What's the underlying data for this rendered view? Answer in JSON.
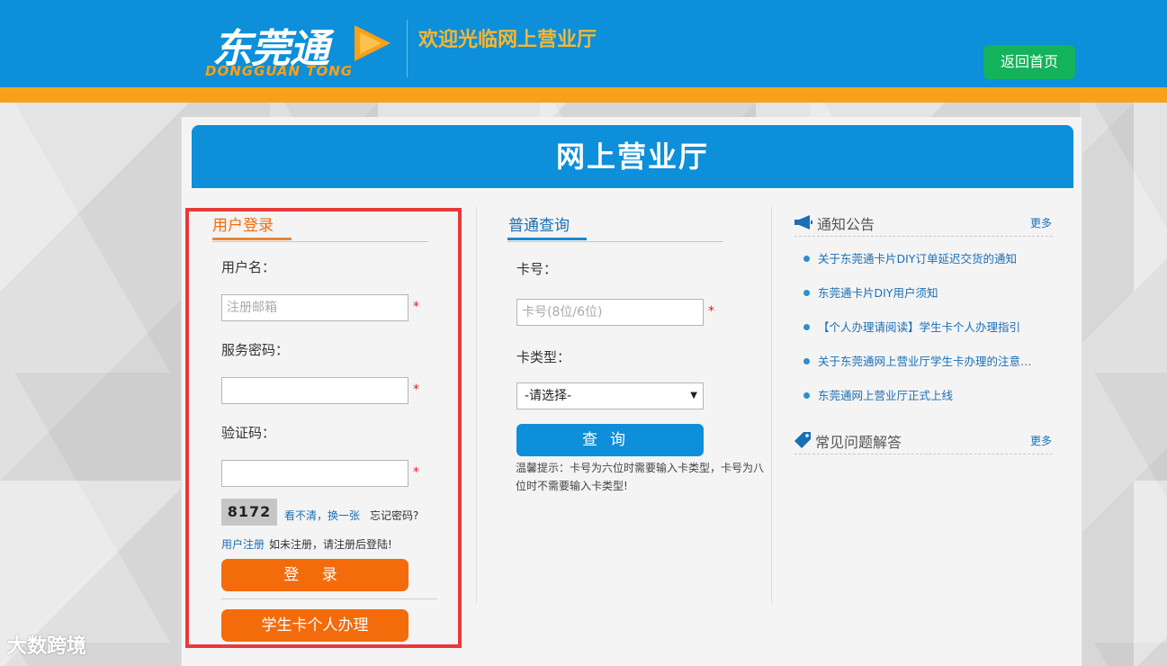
{
  "header": {
    "logo_cn": "东莞通",
    "logo_en": "DONGGUAN TONG",
    "welcome": "欢迎光临网上营业厅",
    "home_button": "返回首页"
  },
  "card_title": "网上营业厅",
  "login": {
    "tab": "用户登录",
    "username_label": "用户名：",
    "username_placeholder": "注册邮箱",
    "password_label": "服务密码：",
    "captcha_label": "验证码：",
    "required_mark": "*",
    "captcha_code": "8172",
    "refresh_captcha": "看不清，换一张",
    "forgot_password": "忘记密码?",
    "register_link": "用户注册",
    "register_hint": "如未注册，请注册后登陆!",
    "login_button": "登 录",
    "student_button": "学生卡个人办理"
  },
  "query": {
    "tab": "普通查询",
    "card_no_label": "卡号：",
    "card_no_placeholder": "卡号(8位/6位)",
    "card_type_label": "卡类型：",
    "card_type_selected": "-请选择-",
    "query_button": "查询",
    "hint": "温馨提示：卡号为六位时需要输入卡类型，卡号为八位时不需要输入卡类型!"
  },
  "notices": {
    "title": "通知公告",
    "more": "更多",
    "items": [
      "关于东莞通卡片DIY订单延迟交货的通知",
      "东莞通卡片DIY用户须知",
      "【个人办理请阅读】学生卡个人办理指引",
      "关于东莞通网上营业厅学生卡办理的注意事项",
      "东莞通网上营业厅正式上线"
    ]
  },
  "faq": {
    "title": "常见问题解答",
    "more": "更多"
  },
  "watermark": "大数跨境",
  "colors": {
    "header_blue": "#0d8fd9",
    "stripe_orange": "#f7a11a",
    "home_green": "#12b35a",
    "button_orange": "#f46b0c",
    "highlight_red": "#e83a3a"
  }
}
